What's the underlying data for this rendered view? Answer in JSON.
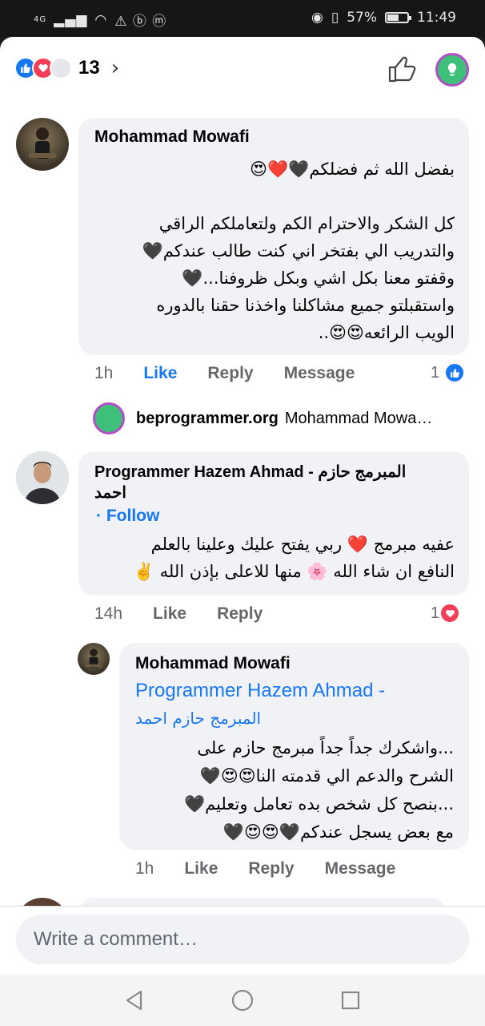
{
  "status_bar": {
    "network": "4G",
    "indicators": "⚠ ⓑ ⓜ",
    "battery": "57%",
    "battery_level": 0.57,
    "time": "11:49"
  },
  "reactions": {
    "count": "13",
    "icons": [
      "like-icon",
      "love-icon",
      "care-icon"
    ]
  },
  "colors": {
    "accent": "#1877f2",
    "love": "#f33e58",
    "bubble": "#f0f2f5",
    "meta_text": "#65676b"
  },
  "comments": [
    {
      "author": "Mohammad Mowafi",
      "lines": [
        "بفضل الله ثم فضلكم🖤❤️😍",
        "",
        "كل الشكر والاحترام الكم ولتعاملكم الراقي",
        "والتدريب الي بفتخر اني كنت طالب عندكم🖤",
        "وقفتو معنا بكل اشي وبكل ظروفنا...🖤",
        "واستقبلتو جميع مشاكلنا واخذنا حقنا بالدوره",
        "الويب الرائعه😍😍.."
      ],
      "time": "1h",
      "actions": [
        "Like",
        "Reply",
        "Message"
      ],
      "reaction_count": "1"
    },
    {
      "author": "Programmer Hazem Ahmad - المبرمج حازم",
      "author_line2": "احمد",
      "follow": "· Follow",
      "lines": [
        "عفيه مبرمج ❤️ ربي يفتح عليك وعلينا بالعلم",
        "النافع ان شاء الله 🌸 منها للاعلى بإذن الله ✌️"
      ],
      "time": "14h",
      "actions": [
        "Like",
        "Reply"
      ],
      "reaction_count": "1"
    },
    {
      "author": "Mohammad Mowafi",
      "mention": "Programmer Hazem Ahmad -",
      "mention_ar": "المبرمج حازم احمد",
      "lines": [
        "...واشكرك جداً جداً مبرمج حازم على",
        "الشرح والدعم الي قدمته النا😍😍🖤",
        "...بنصح كل شخص بده تعامل وتعليم🖤",
        "مع بعض يسجل عندكم🖤😍😍🖤"
      ],
      "time": "1h",
      "actions": [
        "Like",
        "Reply",
        "Message"
      ]
    }
  ],
  "reply_link": {
    "site": "beprogrammer.org",
    "who": "Mohammad Mowa…"
  },
  "composer": {
    "placeholder": "Write a comment…"
  }
}
